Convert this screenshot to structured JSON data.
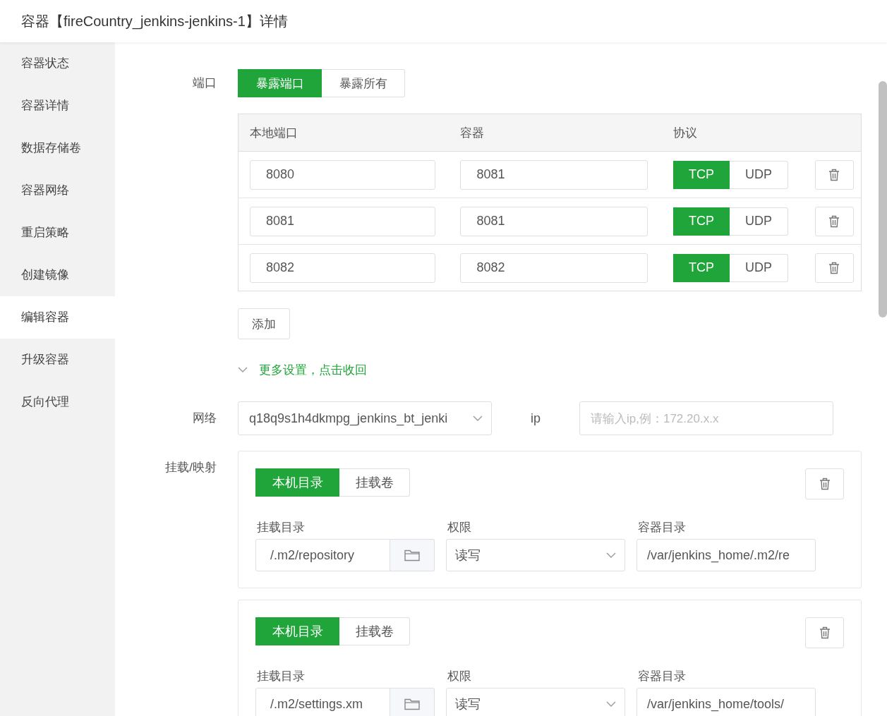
{
  "header": {
    "title": "容器【fireCountry_jenkins-jenkins-1】详情"
  },
  "sidebar": {
    "items": [
      {
        "label": "容器状态",
        "selected": false
      },
      {
        "label": "容器详情",
        "selected": false
      },
      {
        "label": "数据存储卷",
        "selected": false
      },
      {
        "label": "容器网络",
        "selected": false
      },
      {
        "label": "重启策略",
        "selected": false
      },
      {
        "label": "创建镜像",
        "selected": false
      },
      {
        "label": "编辑容器",
        "selected": true
      },
      {
        "label": "升级容器",
        "selected": false
      },
      {
        "label": "反向代理",
        "selected": false
      }
    ]
  },
  "ports": {
    "label": "端口",
    "modes": [
      {
        "label": "暴露端口",
        "selected": true
      },
      {
        "label": "暴露所有",
        "selected": false
      }
    ],
    "columns": [
      "本地端口",
      "容器",
      "协议"
    ],
    "rows": [
      {
        "local": "8080",
        "container": "8081",
        "protocols": [
          {
            "label": "TCP",
            "selected": true
          },
          {
            "label": "UDP",
            "selected": false
          }
        ]
      },
      {
        "local": "8081",
        "container": "8081",
        "protocols": [
          {
            "label": "TCP",
            "selected": true
          },
          {
            "label": "UDP",
            "selected": false
          }
        ]
      },
      {
        "local": "8082",
        "container": "8082",
        "protocols": [
          {
            "label": "TCP",
            "selected": true
          },
          {
            "label": "UDP",
            "selected": false
          }
        ]
      }
    ],
    "add_button": "添加"
  },
  "more_settings": {
    "label": "更多设置，点击收回",
    "expanded": true
  },
  "network": {
    "label": "网络",
    "value": "q18q9s1h4dkmpg_jenkins_bt_jenki",
    "ip_label": "ip",
    "ip_placeholder": "请输入ip,例：172.20.x.x"
  },
  "mounts": {
    "label": "挂载/映射",
    "items": [
      {
        "types": [
          {
            "label": "本机目录",
            "selected": true
          },
          {
            "label": "挂载卷",
            "selected": false
          }
        ],
        "host_dir_label": "挂载目录",
        "host_dir": "/.m2/repository",
        "permission_label": "权限",
        "permission": "读写",
        "container_dir_label": "容器目录",
        "container_dir": "/var/jenkins_home/.m2/re"
      },
      {
        "types": [
          {
            "label": "本机目录",
            "selected": true
          },
          {
            "label": "挂载卷",
            "selected": false
          }
        ],
        "host_dir_label": "挂载目录",
        "host_dir": "/.m2/settings.xm",
        "permission_label": "权限",
        "permission": "读写",
        "container_dir_label": "容器目录",
        "container_dir": "/var/jenkins_home/tools/"
      }
    ]
  }
}
